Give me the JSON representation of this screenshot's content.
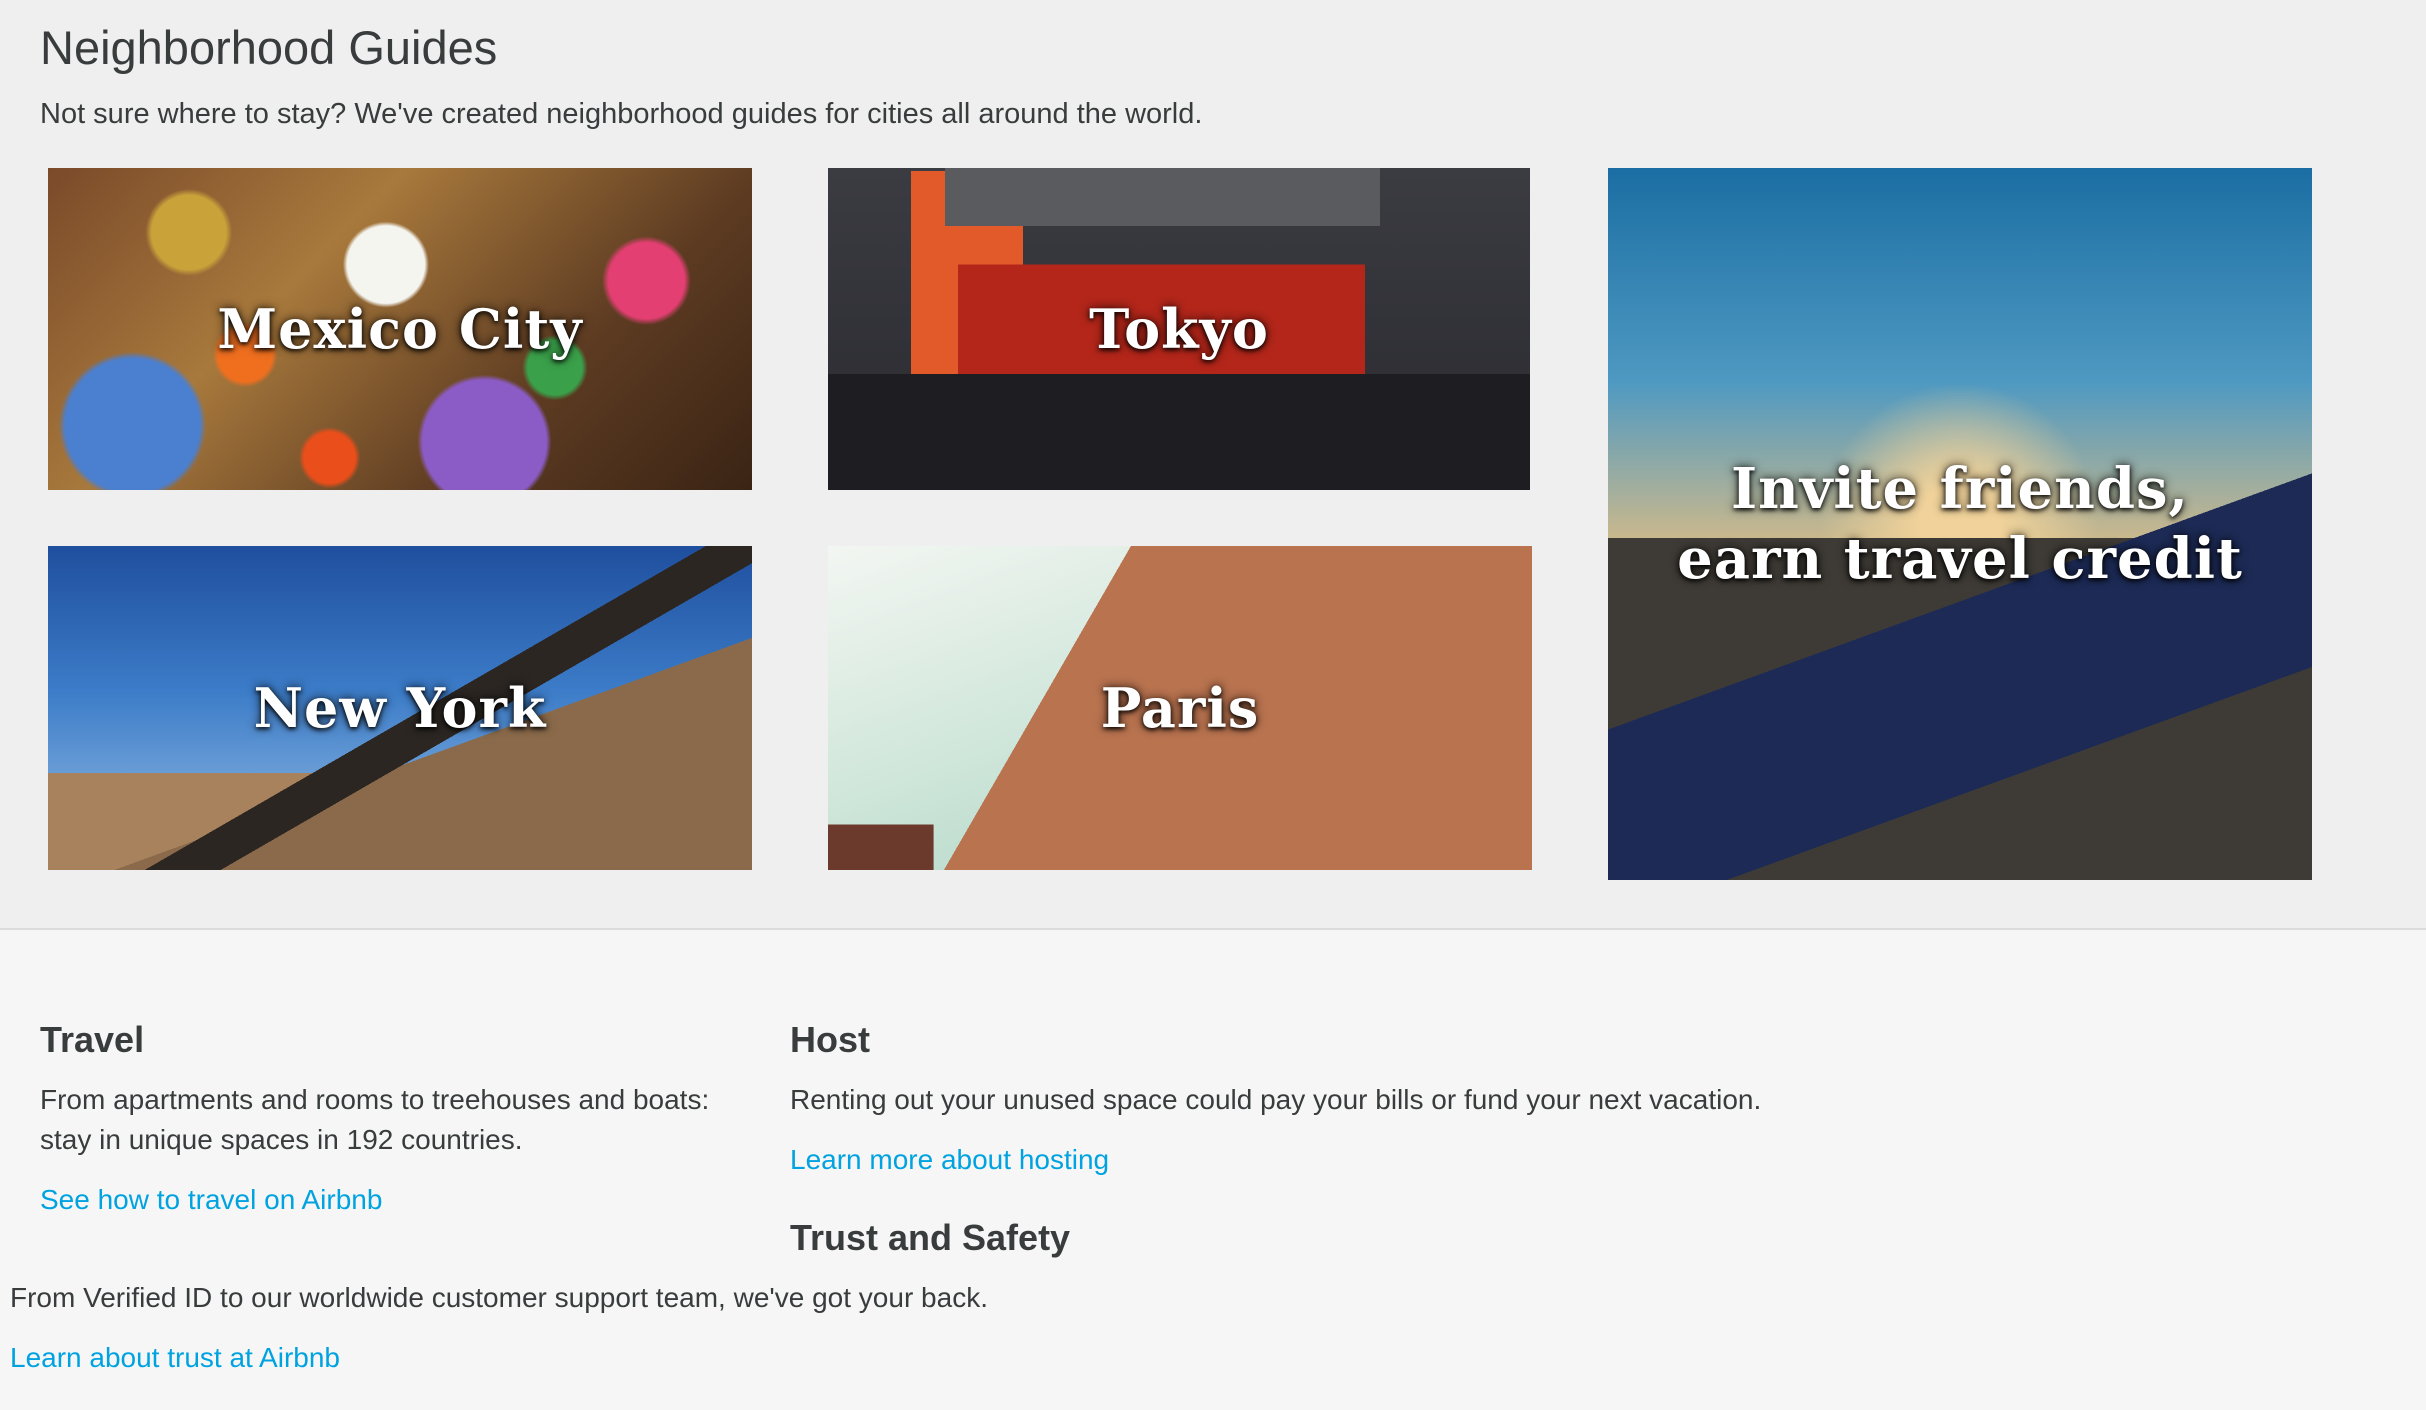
{
  "guides": {
    "title": "Neighborhood Guides",
    "subtitle": "Not sure where to stay? We've created neighborhood guides for cities all around the world.",
    "cities": {
      "mexico_city": "Mexico City",
      "tokyo": "Tokyo",
      "new_york": "New York",
      "paris": "Paris"
    },
    "invite": {
      "line1": "Invite friends,",
      "line2": "earn travel credit"
    }
  },
  "footer": {
    "travel": {
      "title": "Travel",
      "description": "From apartments and rooms to treehouses and boats: stay in unique spaces in 192 countries.",
      "link": "See how to travel on Airbnb"
    },
    "host": {
      "title": "Host",
      "description": "Renting out your unused space could pay your bills or fund your next vacation.",
      "link": "Learn more about hosting"
    },
    "trust": {
      "title": "Trust and Safety",
      "description": "From Verified ID to our worldwide customer support team, we've got your back.",
      "link": "Learn about trust at Airbnb"
    }
  },
  "colors": {
    "link": "#00a3e0",
    "text": "#393c3d",
    "background": "#efefef",
    "footer_background": "#f6f6f6"
  }
}
